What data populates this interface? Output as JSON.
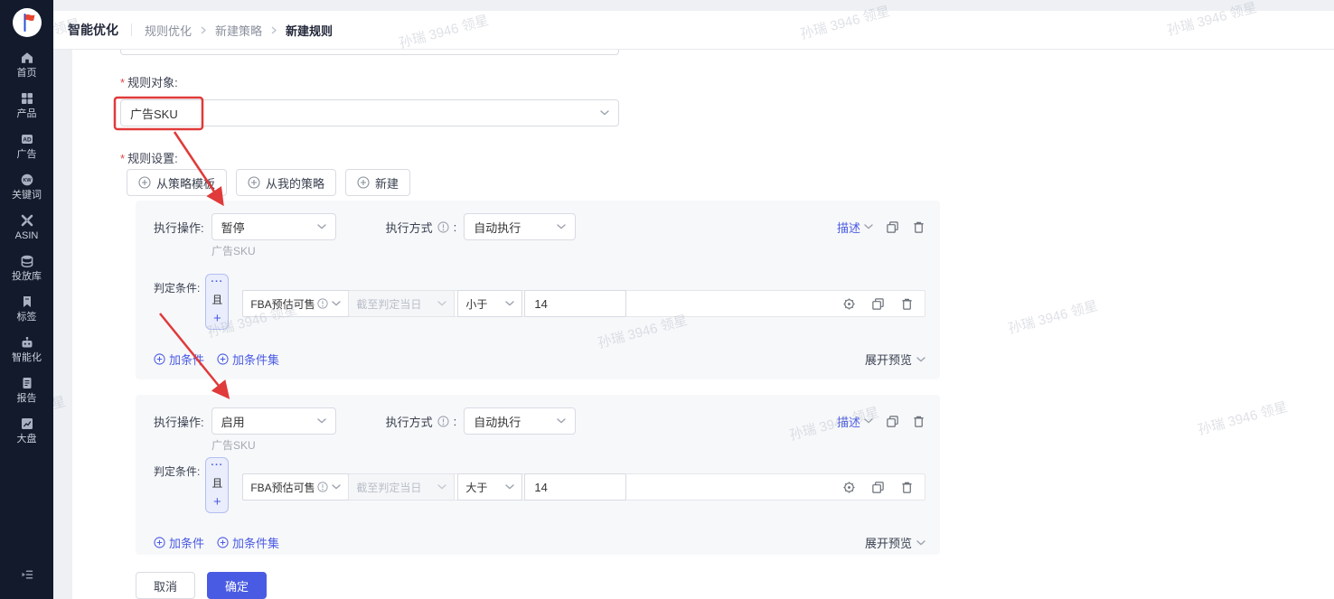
{
  "colors": {
    "primary": "#4a5be3",
    "annotation_red": "#e03a3a",
    "sidebar_bg": "#121a2c",
    "card_bg": "#f7f8fa"
  },
  "watermark": {
    "text": "孙瑞 3946 领星"
  },
  "sidebar": {
    "logo_icon": "lingxing-logo",
    "items": [
      {
        "icon": "home-icon",
        "label": "首页"
      },
      {
        "icon": "products-grid-icon",
        "label": "产品"
      },
      {
        "icon": "ad-badge-icon",
        "label": "广告"
      },
      {
        "icon": "keyword-icon",
        "label": "关键词"
      },
      {
        "icon": "asin-icon",
        "label": "ASIN"
      },
      {
        "icon": "library-database-icon",
        "label": "投放库"
      },
      {
        "icon": "tag-bookmark-icon",
        "label": "标签"
      },
      {
        "icon": "robot-icon",
        "label": "智能化"
      },
      {
        "icon": "report-doc-icon",
        "label": "报告"
      },
      {
        "icon": "market-chart-icon",
        "label": "大盘"
      }
    ]
  },
  "topbar": {
    "section": "智能优化",
    "crumbs": [
      "规则优化",
      "新建策略",
      "新建规则"
    ]
  },
  "form": {
    "required_mark": "*",
    "colon": ":",
    "rule_object": {
      "label": "规则对象:",
      "value": "广告SKU"
    },
    "rule_settings": {
      "label": "规则设置:",
      "buttons": [
        "从策略模板",
        "从我的策略",
        "新建"
      ]
    },
    "cards": [
      {
        "action_label": "执行操作:",
        "action_value": "暂停",
        "action_target": "广告SKU",
        "mode_label": "执行方式",
        "mode_value": "自动执行",
        "describe": "描述",
        "cond_label": "判定条件:",
        "logic_more": "···",
        "logic_and": "且",
        "logic_add": "+",
        "cond_field": "FBA预估可售...",
        "cond_period": "截至判定当日",
        "cond_op": "小于",
        "cond_value": "14",
        "add_condition": "加条件",
        "add_condition_set": "加条件集",
        "expand_preview": "展开预览"
      },
      {
        "action_label": "执行操作:",
        "action_value": "启用",
        "action_target": "广告SKU",
        "mode_label": "执行方式",
        "mode_value": "自动执行",
        "describe": "描述",
        "cond_label": "判定条件:",
        "logic_more": "···",
        "logic_and": "且",
        "logic_add": "+",
        "cond_field": "FBA预估可售...",
        "cond_period": "截至判定当日",
        "cond_op": "大于",
        "cond_value": "14",
        "add_condition": "加条件",
        "add_condition_set": "加条件集",
        "expand_preview": "展开预览"
      }
    ],
    "footer": {
      "cancel": "取消",
      "confirm": "确定"
    }
  }
}
